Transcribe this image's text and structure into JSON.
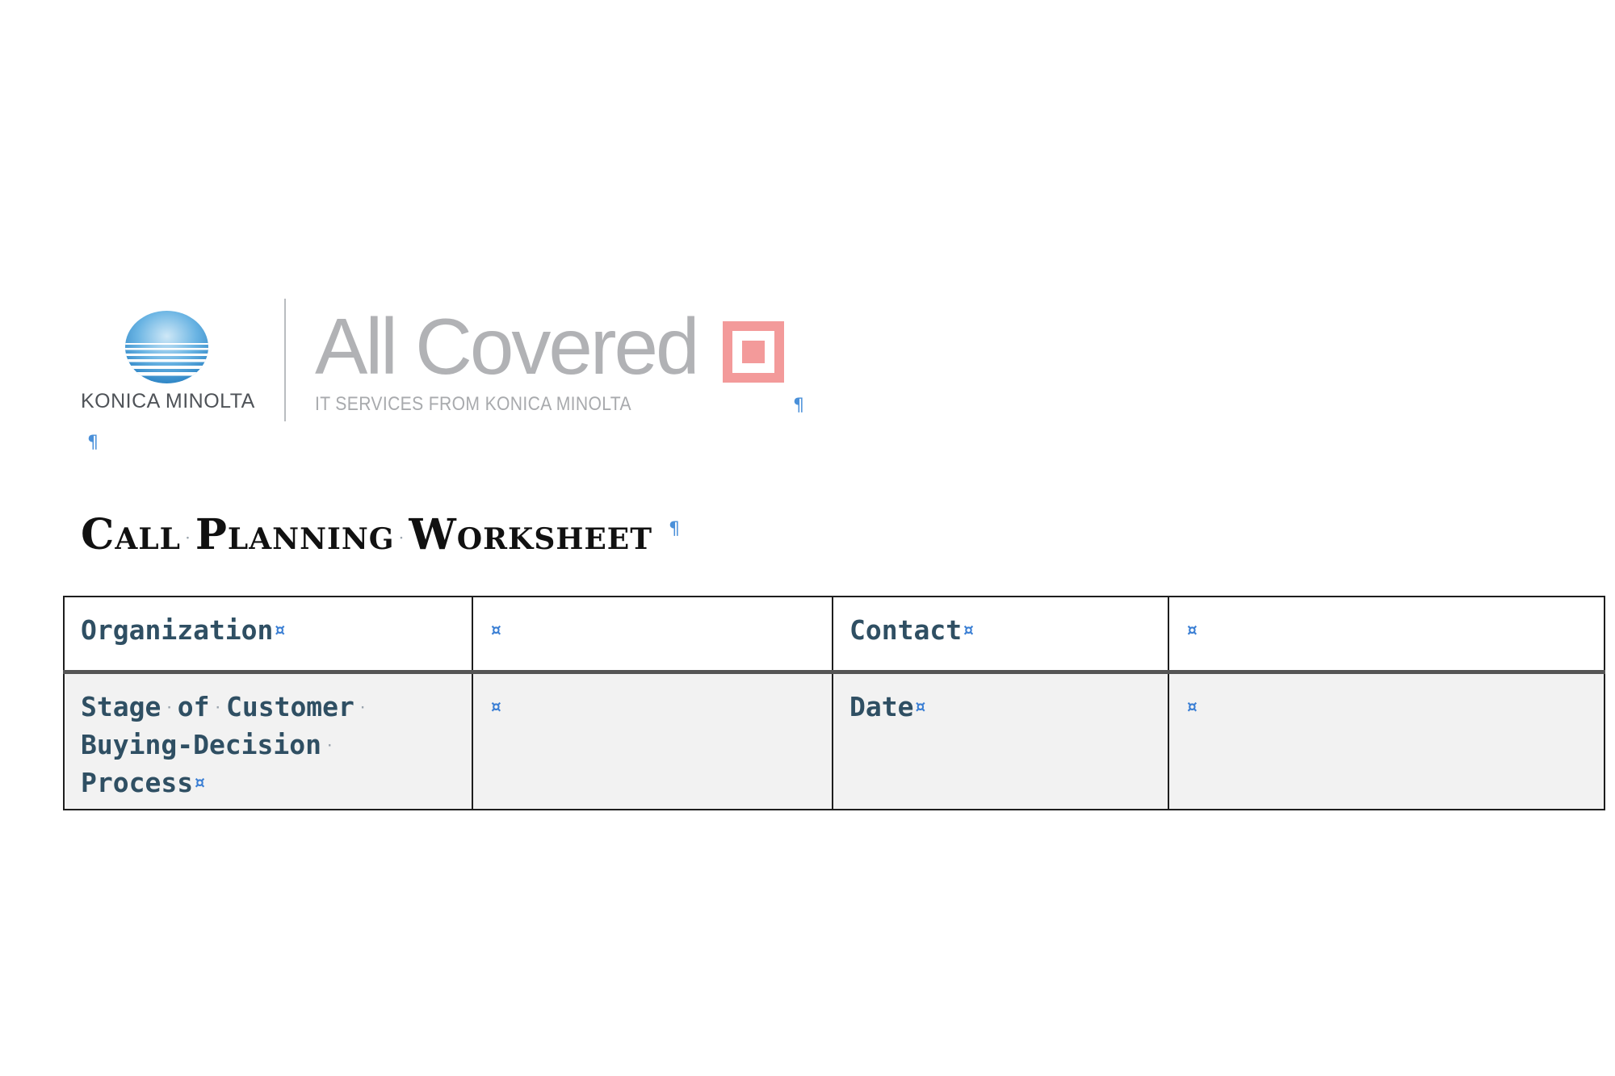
{
  "logo": {
    "konica_text": "KONICA MINOLTA",
    "allcovered_text": "All Covered",
    "tagline": "IT SERVICES FROM KONICA MINOLTA"
  },
  "marks": {
    "pilcrow": "¶",
    "cell_end": "¤",
    "space": "·"
  },
  "title": {
    "word1": "Call",
    "word2": "Planning",
    "word3": "Worksheet"
  },
  "table": {
    "row1": {
      "label1": "Organization",
      "value1": "",
      "label2": "Contact",
      "value2": ""
    },
    "row2": {
      "label1_line1_w1": "Stage",
      "label1_line1_w2": "of",
      "label1_line1_w3": "Customer",
      "label1_line2": "Buying-Decision",
      "label1_line3": "Process",
      "value1": "",
      "label2": "Date",
      "value2": ""
    }
  },
  "colors": {
    "header_text": "#2f4f63",
    "formatting_marks": "#3b7fd4",
    "allcovered_gray": "#b1b2b5",
    "allcovered_accent": "#f39a9a",
    "row2_background": "#f2f2f2"
  },
  "icons": {
    "konica_globe": "konica-minolta-globe-icon",
    "allcovered_square": "allcovered-square-icon"
  }
}
